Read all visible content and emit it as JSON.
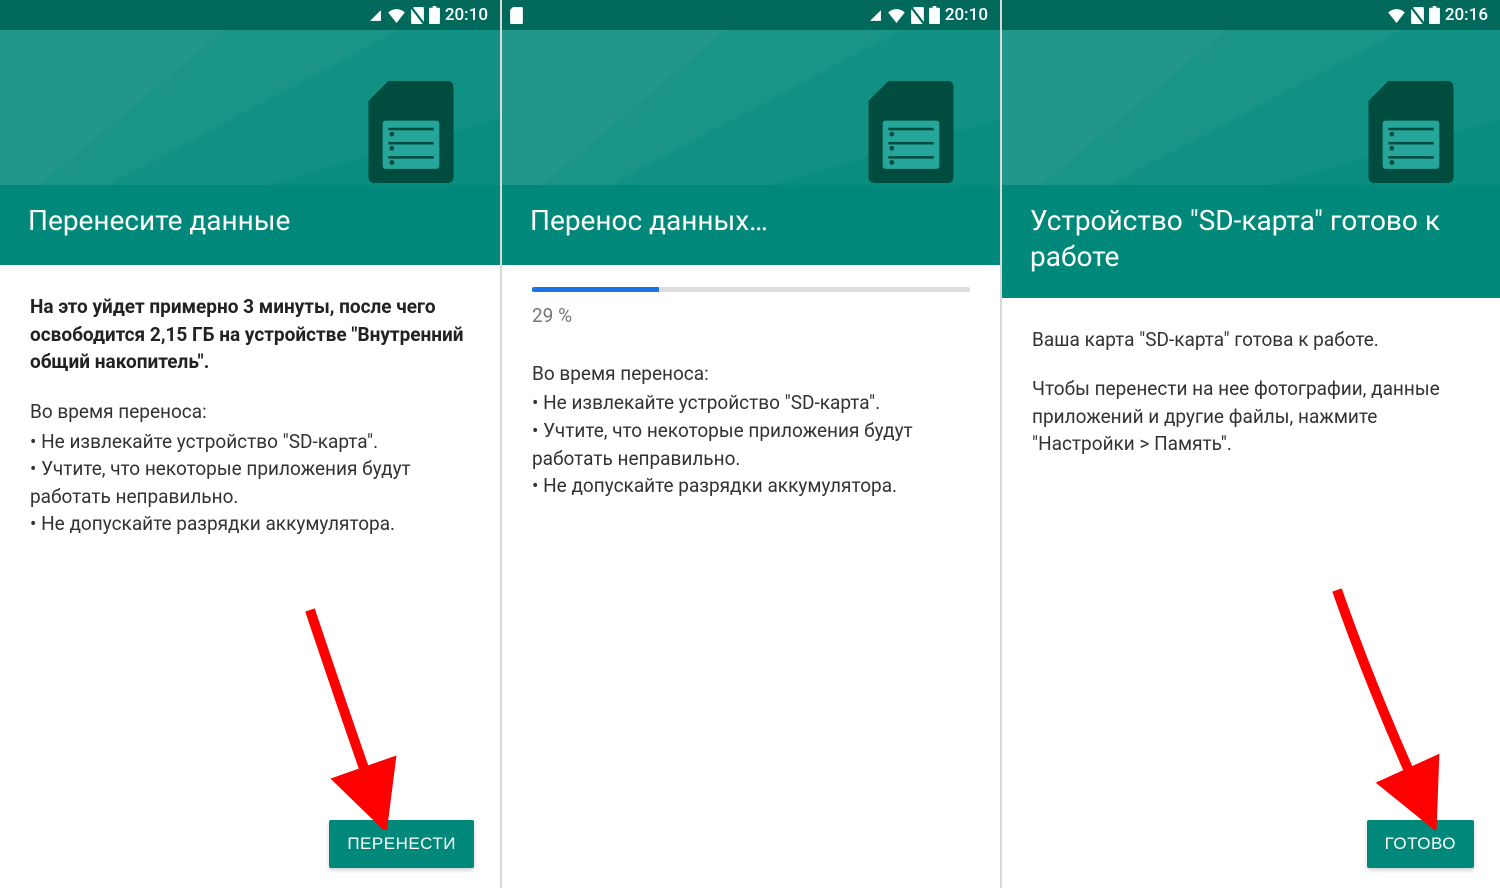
{
  "colors": {
    "teal": "#00897b",
    "tealDark": "#00695c",
    "blue": "#1a73e8",
    "red": "#ff0000"
  },
  "screens": [
    {
      "statusTime": "20:10",
      "statusLeft": [],
      "title": "Перенесите данные",
      "lead": "На это уйдет примерно 3 минуты, после чего освободится 2,15 ГБ на устройстве \"Внутренний общий накопитель\".",
      "subhead": "Во время переноса:",
      "bullets": [
        "• Не извлекайте устройство \"SD-карта\".",
        "• Учтите, что некоторые приложения будут работать неправильно.",
        "• Не допускайте разрядки аккумулятора."
      ],
      "button": "ПЕРЕНЕСТИ",
      "arrow": true
    },
    {
      "statusTime": "20:10",
      "statusLeft": [
        "sd"
      ],
      "title": "Перенос данных…",
      "progressPercent": "29 %",
      "progressValue": 29,
      "subhead": "Во время переноса:",
      "bullets": [
        "• Не извлекайте устройство \"SD-карта\".",
        "• Учтите, что некоторые приложения будут работать неправильно.",
        "• Не допускайте разрядки аккумулятора."
      ],
      "button": null,
      "arrow": false
    },
    {
      "statusTime": "20:16",
      "statusLeft": [],
      "title": "Устройство \"SD-карта\" готово к работе",
      "paras": [
        "Ваша карта \"SD-карта\" готова к работе.",
        "Чтобы перенести на нее фотографии, данные приложений и другие файлы, нажмите \"Настройки > Память\"."
      ],
      "button": "ГОТОВО",
      "arrow": true
    }
  ]
}
